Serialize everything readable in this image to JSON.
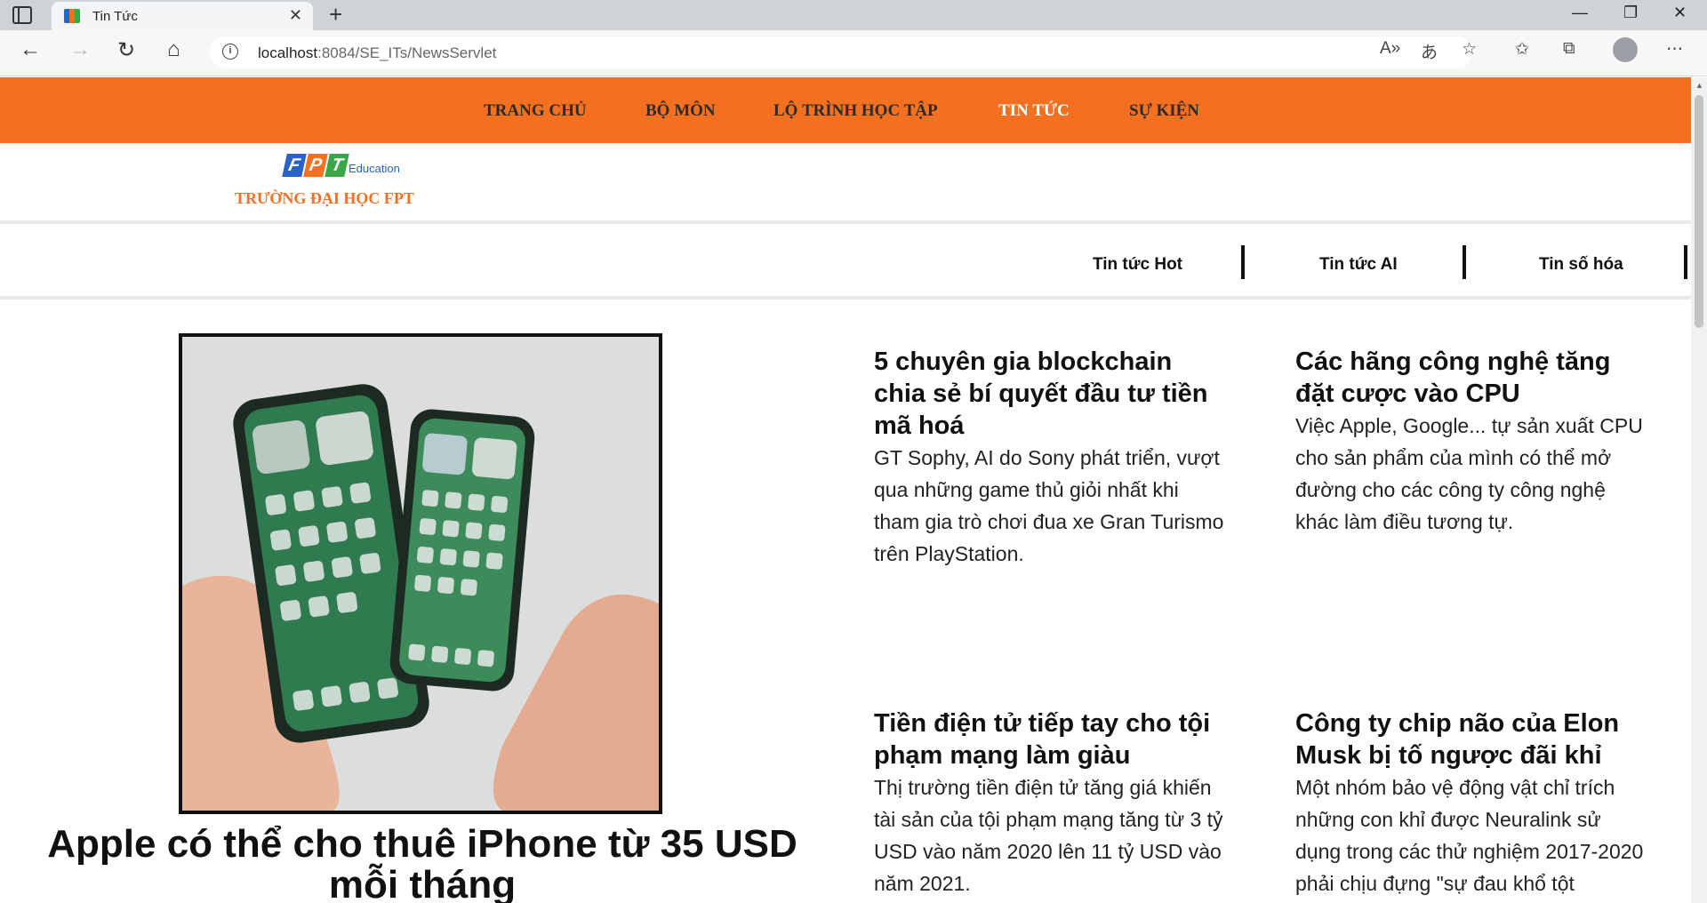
{
  "browser": {
    "tab_title": "Tin Tức",
    "url_host": "localhost",
    "url_rest": ":8084/SE_ITs/NewsServlet"
  },
  "topnav": {
    "items": [
      "TRANG CHỦ",
      "BỘ MÔN",
      "LỘ TRÌNH HỌC TẬP",
      "TIN TỨC",
      "SỰ KIỆN"
    ],
    "active": "TIN TỨC",
    "color": "#f37021"
  },
  "logo": {
    "letters": [
      "F",
      "P",
      "T"
    ],
    "sub": "Education",
    "school": "TRƯỜNG ĐẠI HỌC FPT"
  },
  "subnav": {
    "items": [
      "Tin tức Hot",
      "Tin tức AI",
      "Tin số hóa"
    ]
  },
  "hero": {
    "title": "Apple có thể cho thuê iPhone từ 35 USD mỗi tháng"
  },
  "articles": [
    {
      "title": "5 chuyên gia blockchain chia sẻ bí quyết đầu tư tiền mã hoá",
      "summary": "GT Sophy, AI do Sony phát triển, vượt qua những game thủ giỏi nhất khi tham gia trò chơi đua xe Gran Turismo trên PlayStation."
    },
    {
      "title": "Các hãng công nghệ tăng đặt cược vào CPU",
      "summary": "Việc Apple, Google... tự sản xuất CPU cho sản phẩm của mình có thể mở đường cho các công ty công nghệ khác làm điều tương tự."
    },
    {
      "title": "Tiền điện tử tiếp tay cho tội phạm mạng làm giàu",
      "summary": "Thị trường tiền điện tử tăng giá khiến tài sản của tội phạm mạng tăng từ 3 tỷ USD vào năm 2020 lên 11 tỷ USD vào năm 2021."
    },
    {
      "title": "Công ty chip não của Elon Musk bị tố ngược đãi khỉ",
      "summary": "Một nhóm bảo vệ động vật chỉ trích những con khỉ được Neuralink sử dụng trong các thử nghiệm 2017-2020 phải chịu đựng \"sự đau khổ tột"
    }
  ]
}
